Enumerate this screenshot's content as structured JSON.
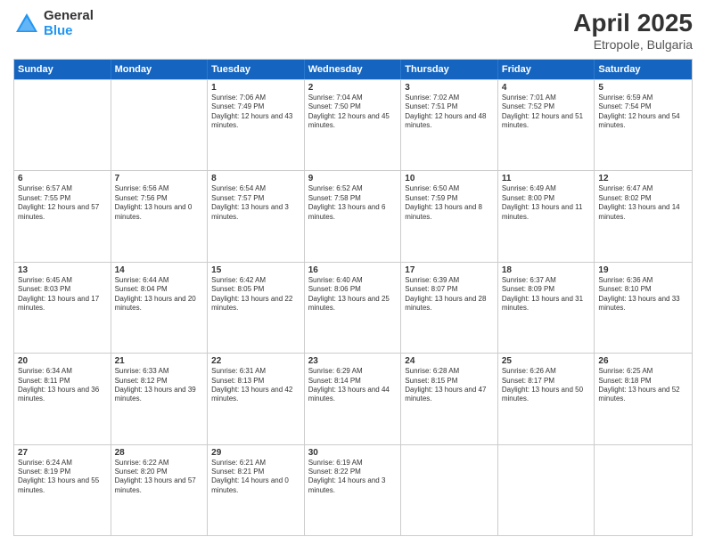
{
  "header": {
    "logo_general": "General",
    "logo_blue": "Blue",
    "title": "April 2025",
    "location": "Etropole, Bulgaria"
  },
  "days_of_week": [
    "Sunday",
    "Monday",
    "Tuesday",
    "Wednesday",
    "Thursday",
    "Friday",
    "Saturday"
  ],
  "weeks": [
    [
      {
        "day": "",
        "sunrise": "",
        "sunset": "",
        "daylight": ""
      },
      {
        "day": "",
        "sunrise": "",
        "sunset": "",
        "daylight": ""
      },
      {
        "day": "1",
        "sunrise": "Sunrise: 7:06 AM",
        "sunset": "Sunset: 7:49 PM",
        "daylight": "Daylight: 12 hours and 43 minutes."
      },
      {
        "day": "2",
        "sunrise": "Sunrise: 7:04 AM",
        "sunset": "Sunset: 7:50 PM",
        "daylight": "Daylight: 12 hours and 45 minutes."
      },
      {
        "day": "3",
        "sunrise": "Sunrise: 7:02 AM",
        "sunset": "Sunset: 7:51 PM",
        "daylight": "Daylight: 12 hours and 48 minutes."
      },
      {
        "day": "4",
        "sunrise": "Sunrise: 7:01 AM",
        "sunset": "Sunset: 7:52 PM",
        "daylight": "Daylight: 12 hours and 51 minutes."
      },
      {
        "day": "5",
        "sunrise": "Sunrise: 6:59 AM",
        "sunset": "Sunset: 7:54 PM",
        "daylight": "Daylight: 12 hours and 54 minutes."
      }
    ],
    [
      {
        "day": "6",
        "sunrise": "Sunrise: 6:57 AM",
        "sunset": "Sunset: 7:55 PM",
        "daylight": "Daylight: 12 hours and 57 minutes."
      },
      {
        "day": "7",
        "sunrise": "Sunrise: 6:56 AM",
        "sunset": "Sunset: 7:56 PM",
        "daylight": "Daylight: 13 hours and 0 minutes."
      },
      {
        "day": "8",
        "sunrise": "Sunrise: 6:54 AM",
        "sunset": "Sunset: 7:57 PM",
        "daylight": "Daylight: 13 hours and 3 minutes."
      },
      {
        "day": "9",
        "sunrise": "Sunrise: 6:52 AM",
        "sunset": "Sunset: 7:58 PM",
        "daylight": "Daylight: 13 hours and 6 minutes."
      },
      {
        "day": "10",
        "sunrise": "Sunrise: 6:50 AM",
        "sunset": "Sunset: 7:59 PM",
        "daylight": "Daylight: 13 hours and 8 minutes."
      },
      {
        "day": "11",
        "sunrise": "Sunrise: 6:49 AM",
        "sunset": "Sunset: 8:00 PM",
        "daylight": "Daylight: 13 hours and 11 minutes."
      },
      {
        "day": "12",
        "sunrise": "Sunrise: 6:47 AM",
        "sunset": "Sunset: 8:02 PM",
        "daylight": "Daylight: 13 hours and 14 minutes."
      }
    ],
    [
      {
        "day": "13",
        "sunrise": "Sunrise: 6:45 AM",
        "sunset": "Sunset: 8:03 PM",
        "daylight": "Daylight: 13 hours and 17 minutes."
      },
      {
        "day": "14",
        "sunrise": "Sunrise: 6:44 AM",
        "sunset": "Sunset: 8:04 PM",
        "daylight": "Daylight: 13 hours and 20 minutes."
      },
      {
        "day": "15",
        "sunrise": "Sunrise: 6:42 AM",
        "sunset": "Sunset: 8:05 PM",
        "daylight": "Daylight: 13 hours and 22 minutes."
      },
      {
        "day": "16",
        "sunrise": "Sunrise: 6:40 AM",
        "sunset": "Sunset: 8:06 PM",
        "daylight": "Daylight: 13 hours and 25 minutes."
      },
      {
        "day": "17",
        "sunrise": "Sunrise: 6:39 AM",
        "sunset": "Sunset: 8:07 PM",
        "daylight": "Daylight: 13 hours and 28 minutes."
      },
      {
        "day": "18",
        "sunrise": "Sunrise: 6:37 AM",
        "sunset": "Sunset: 8:09 PM",
        "daylight": "Daylight: 13 hours and 31 minutes."
      },
      {
        "day": "19",
        "sunrise": "Sunrise: 6:36 AM",
        "sunset": "Sunset: 8:10 PM",
        "daylight": "Daylight: 13 hours and 33 minutes."
      }
    ],
    [
      {
        "day": "20",
        "sunrise": "Sunrise: 6:34 AM",
        "sunset": "Sunset: 8:11 PM",
        "daylight": "Daylight: 13 hours and 36 minutes."
      },
      {
        "day": "21",
        "sunrise": "Sunrise: 6:33 AM",
        "sunset": "Sunset: 8:12 PM",
        "daylight": "Daylight: 13 hours and 39 minutes."
      },
      {
        "day": "22",
        "sunrise": "Sunrise: 6:31 AM",
        "sunset": "Sunset: 8:13 PM",
        "daylight": "Daylight: 13 hours and 42 minutes."
      },
      {
        "day": "23",
        "sunrise": "Sunrise: 6:29 AM",
        "sunset": "Sunset: 8:14 PM",
        "daylight": "Daylight: 13 hours and 44 minutes."
      },
      {
        "day": "24",
        "sunrise": "Sunrise: 6:28 AM",
        "sunset": "Sunset: 8:15 PM",
        "daylight": "Daylight: 13 hours and 47 minutes."
      },
      {
        "day": "25",
        "sunrise": "Sunrise: 6:26 AM",
        "sunset": "Sunset: 8:17 PM",
        "daylight": "Daylight: 13 hours and 50 minutes."
      },
      {
        "day": "26",
        "sunrise": "Sunrise: 6:25 AM",
        "sunset": "Sunset: 8:18 PM",
        "daylight": "Daylight: 13 hours and 52 minutes."
      }
    ],
    [
      {
        "day": "27",
        "sunrise": "Sunrise: 6:24 AM",
        "sunset": "Sunset: 8:19 PM",
        "daylight": "Daylight: 13 hours and 55 minutes."
      },
      {
        "day": "28",
        "sunrise": "Sunrise: 6:22 AM",
        "sunset": "Sunset: 8:20 PM",
        "daylight": "Daylight: 13 hours and 57 minutes."
      },
      {
        "day": "29",
        "sunrise": "Sunrise: 6:21 AM",
        "sunset": "Sunset: 8:21 PM",
        "daylight": "Daylight: 14 hours and 0 minutes."
      },
      {
        "day": "30",
        "sunrise": "Sunrise: 6:19 AM",
        "sunset": "Sunset: 8:22 PM",
        "daylight": "Daylight: 14 hours and 3 minutes."
      },
      {
        "day": "",
        "sunrise": "",
        "sunset": "",
        "daylight": ""
      },
      {
        "day": "",
        "sunrise": "",
        "sunset": "",
        "daylight": ""
      },
      {
        "day": "",
        "sunrise": "",
        "sunset": "",
        "daylight": ""
      }
    ]
  ]
}
